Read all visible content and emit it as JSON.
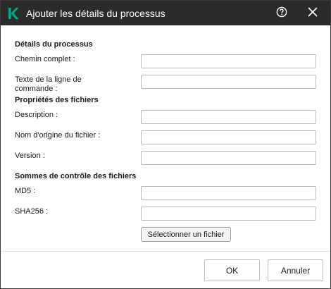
{
  "window": {
    "title": "Ajouter les détails du processus",
    "logo_icon": "kaspersky-k-logo",
    "help_icon": "help-circle-icon",
    "close_icon": "close-icon",
    "brand_color": "#00a88e",
    "titlebar_color": "#2b2b2b"
  },
  "process_details": {
    "title": "Détails du processus",
    "full_path": {
      "label": "Chemin complet :",
      "value": ""
    },
    "command_line": {
      "label": "Texte de la ligne de commande :",
      "value": ""
    }
  },
  "file_properties": {
    "title": "Propriétés des fichiers",
    "description": {
      "label": "Description :",
      "value": ""
    },
    "original_name": {
      "label": "Nom d'origine du fichier :",
      "value": ""
    },
    "version": {
      "label": "Version :",
      "value": ""
    }
  },
  "checksums": {
    "title": "Sommes de contrôle des fichiers",
    "md5": {
      "label": "MD5 :",
      "value": ""
    },
    "sha256": {
      "label": "SHA256 :",
      "value": ""
    },
    "select_file_label": "Sélectionner un fichier"
  },
  "footer": {
    "ok_label": "OK",
    "cancel_label": "Annuler"
  }
}
